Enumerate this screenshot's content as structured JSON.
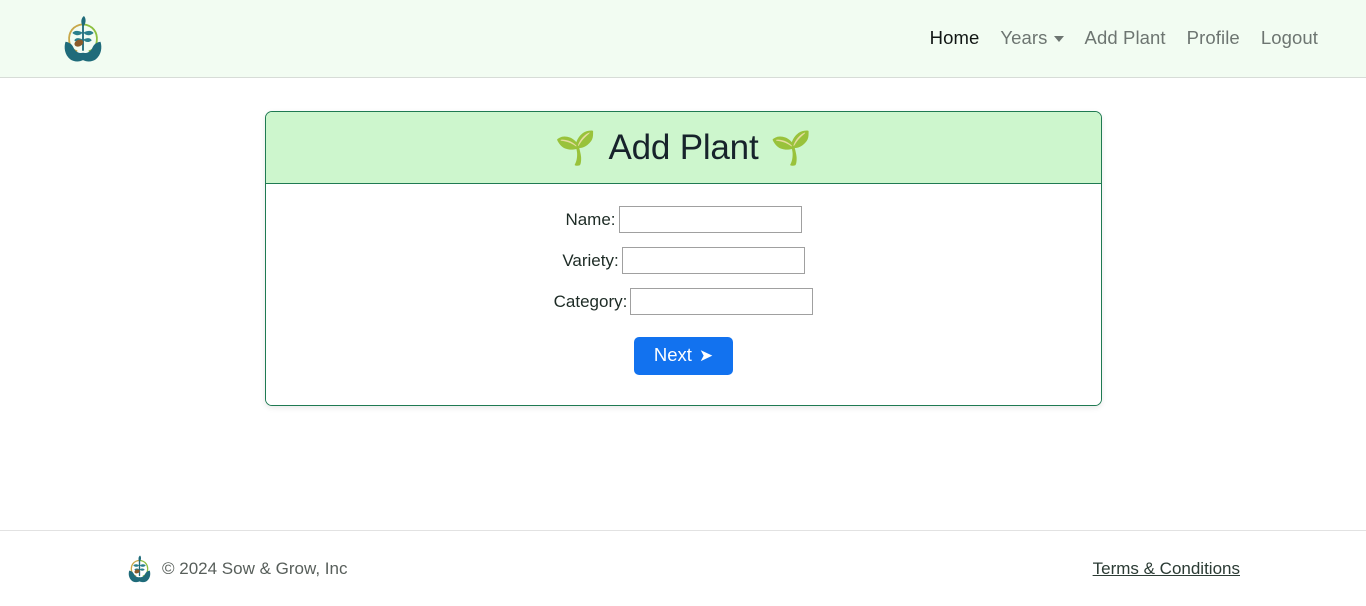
{
  "navbar": {
    "logo_icon": "sow-and-grow-logo",
    "links": [
      {
        "label": "Home",
        "name": "nav-link-home",
        "active": true,
        "caret": false
      },
      {
        "label": "Years",
        "name": "nav-link-years",
        "active": false,
        "caret": true
      },
      {
        "label": "Add Plant",
        "name": "nav-link-add-plant",
        "active": false,
        "caret": false
      },
      {
        "label": "Profile",
        "name": "nav-link-profile",
        "active": false,
        "caret": false
      },
      {
        "label": "Logout",
        "name": "nav-link-logout",
        "active": false,
        "caret": false
      }
    ]
  },
  "card": {
    "title": "Add Plant",
    "left_icon": "🌱",
    "right_icon": "🌱",
    "header_bg": "#cdf6cd",
    "border_color": "#1f7a52",
    "fields": [
      {
        "label": "Name:",
        "value": "",
        "placeholder": ""
      },
      {
        "label": "Variety:",
        "value": "",
        "placeholder": ""
      },
      {
        "label": "Category:",
        "value": "",
        "placeholder": ""
      }
    ],
    "submit": {
      "label": "Next",
      "arrow": "➤",
      "color": "#1272ef"
    }
  },
  "footer": {
    "logo_icon": "sow-and-grow-logo",
    "copyright": "© 2024 Sow & Grow, Inc",
    "terms_label": "Terms & Conditions"
  }
}
